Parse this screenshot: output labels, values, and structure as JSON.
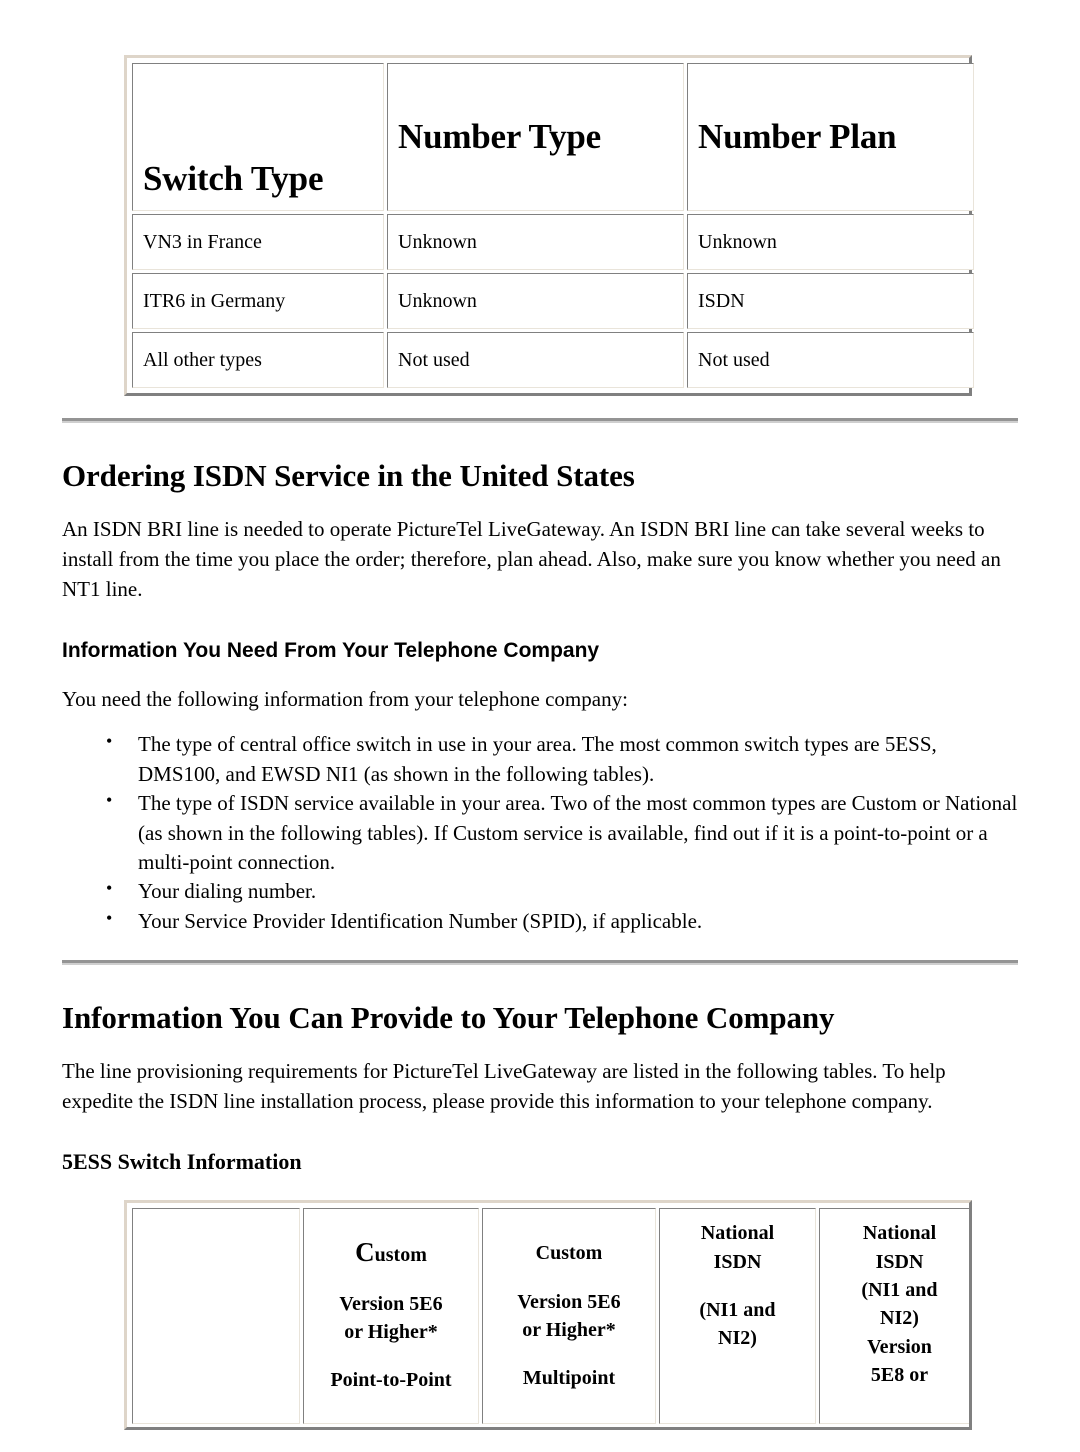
{
  "top_table": {
    "headers": [
      "Switch Type",
      "Number Type",
      "Number Plan"
    ],
    "rows": [
      [
        "VN3 in France",
        "Unknown",
        "Unknown"
      ],
      [
        "ITR6 in Germany",
        "Unknown",
        "ISDN"
      ],
      [
        "All other types",
        "Not used",
        "Not used"
      ]
    ]
  },
  "section1": {
    "heading": "Ordering ISDN Service in the United States",
    "paragraph": "An ISDN BRI line is needed to operate PictureTel LiveGateway. An ISDN BRI line can take several weeks to install from the time you place the order; therefore, plan ahead. Also, make sure you know whether you need an NT1 line.",
    "subheading": "Information You Need From Your Telephone Company",
    "intro": "You need the following information from your telephone company:",
    "bullets": [
      "The type of central office switch in use in your area. The most common switch types are 5ESS, DMS100, and EWSD NI1 (as shown in the following tables).",
      "The type of ISDN service available in your area. Two of the most common types are Custom or National (as shown in the following tables). If Custom service is available, find out if it is a point-to-point or a multi-point connection.",
      "Your dialing number.",
      "Your Service Provider Identification Number (SPID), if applicable."
    ]
  },
  "section2": {
    "heading": "Information You Can Provide to Your Telephone Company",
    "paragraph": "The line provisioning requirements for PictureTel LiveGateway are listed in the following tables. To help expedite the ISDN line installation process, please provide this information to your telephone company.",
    "subheading": "5ESS Switch Information"
  },
  "bottom_table": {
    "col1": "",
    "col2": {
      "l1": "Custom",
      "l1_cap": "C",
      "l1_rest": "ustom",
      "l2": "Version 5E6",
      "l3": "or Higher*",
      "l4": "Point-to-Point"
    },
    "col3": {
      "l1": "Custom",
      "l2": "Version 5E6",
      "l3": "or Higher*",
      "l4": "Multipoint"
    },
    "col4": {
      "l1": "National",
      "l2": "ISDN",
      "l3": "(NI1 and",
      "l4": "NI2)"
    },
    "col5": {
      "l1": "National",
      "l2": "ISDN",
      "l3": "(NI1 and",
      "l4": "NI2)",
      "l5": "Version",
      "l6": "5E8 or"
    }
  },
  "colors": {
    "table_border_light": "#ded5c9",
    "table_border_dark": "#808080",
    "rule": "#949494",
    "text": "#000000",
    "background": "#ffffff"
  }
}
